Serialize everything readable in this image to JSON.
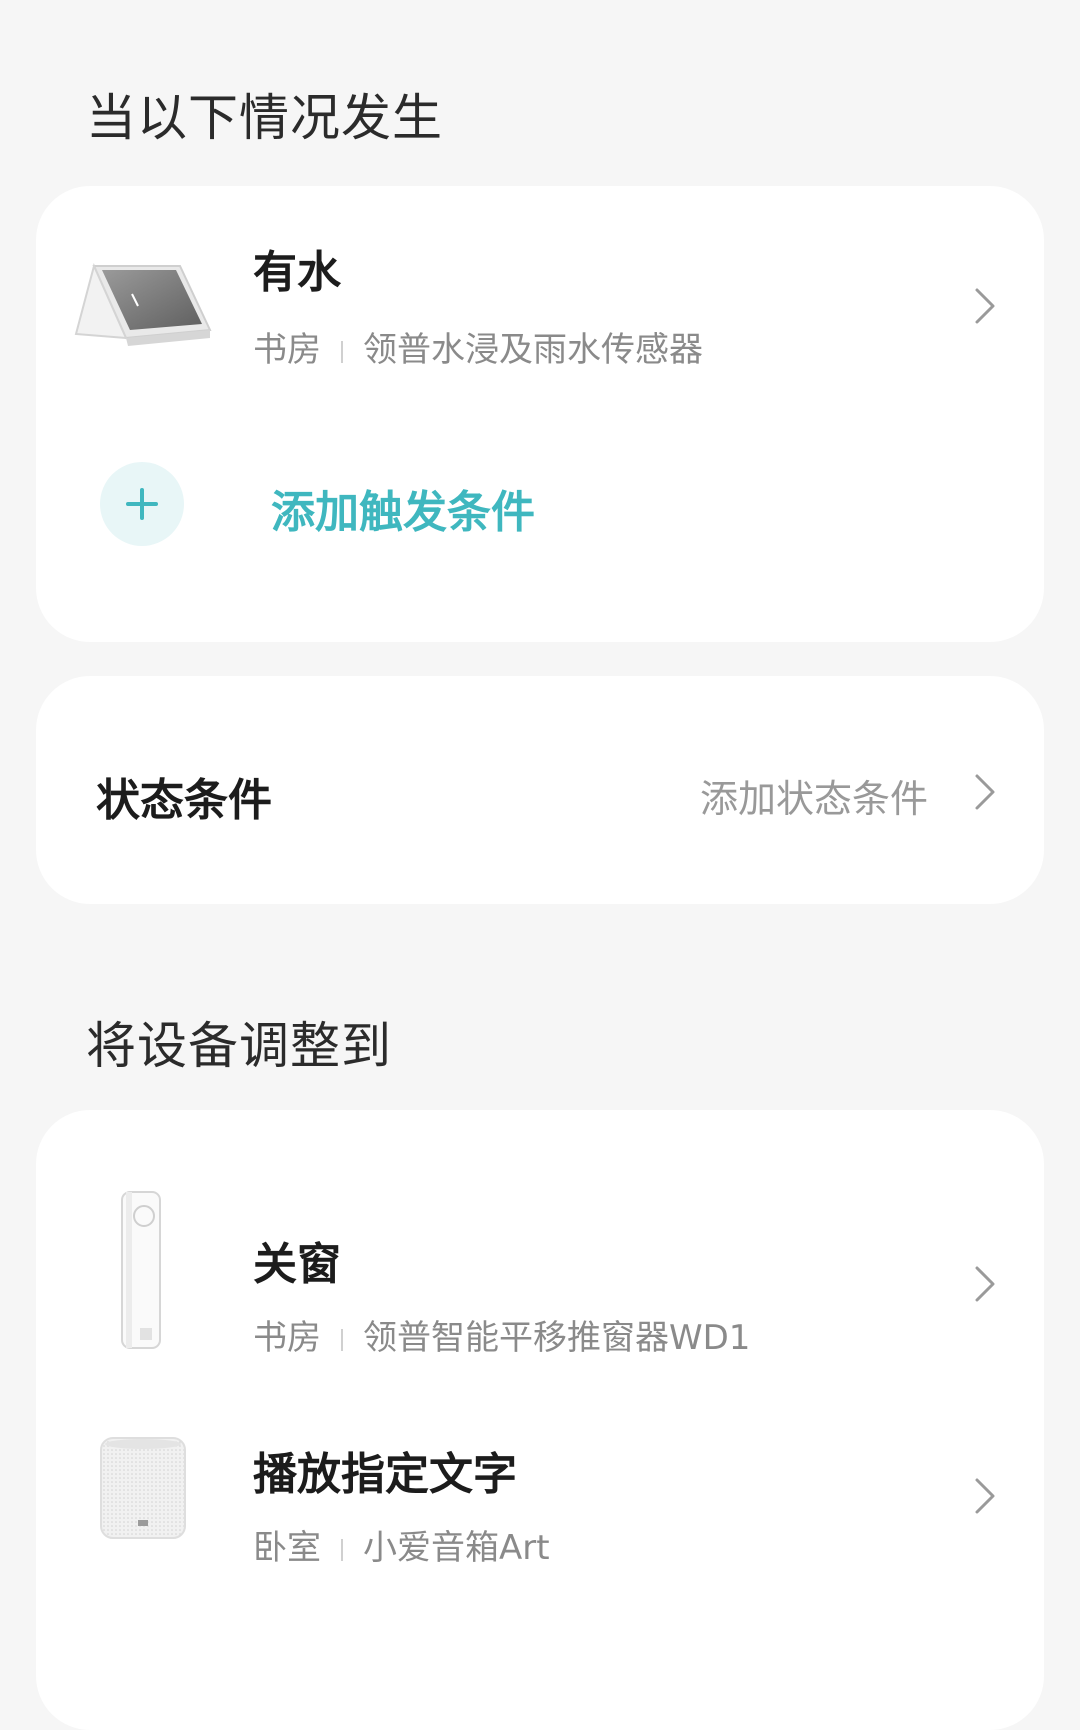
{
  "trigger_section": {
    "title": "当以下情况发生",
    "trigger": {
      "title": "有水",
      "room": "书房",
      "device": "领普水浸及雨水传感器",
      "icon": "water-sensor-image"
    },
    "add_label": "添加触发条件",
    "add_icon": "plus-icon"
  },
  "status_section": {
    "title": "状态条件",
    "action_label": "添加状态条件"
  },
  "action_section": {
    "title": "将设备调整到",
    "actions": [
      {
        "title": "关窗",
        "room": "书房",
        "device": "领普智能平移推窗器WD1",
        "icon": "window-pusher-image"
      },
      {
        "title": "播放指定文字",
        "room": "卧室",
        "device": "小爱音箱Art",
        "icon": "smart-speaker-image"
      }
    ]
  },
  "colors": {
    "accent": "#3fb7bf",
    "background": "#f6f6f6",
    "card": "#ffffff"
  }
}
